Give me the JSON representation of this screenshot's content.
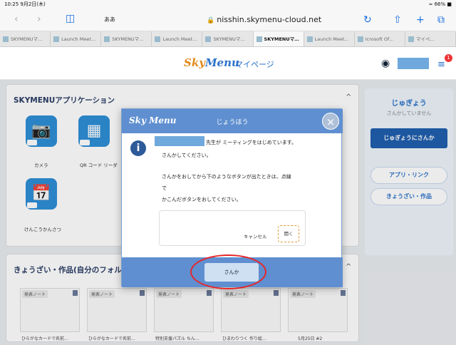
{
  "status": {
    "time": "10:25  9月2日(木)",
    "battery": "≈ 66% ■"
  },
  "browser": {
    "domain": "nisshin.skymenu-cloud.net",
    "aa": "ああ"
  },
  "tabs": [
    "SKYMENUマ…",
    "Launch Meet…",
    "SKYMENUマ…",
    "Launch Meet…",
    "SKYMENUマ…",
    "SKYMENUマ…",
    "Launch Meet…",
    "Icrosoft Of…",
    "マイペ…"
  ],
  "header": {
    "logo_a": "Sky",
    "logo_b": "Menu",
    "mypage": "マイページ",
    "badge": "1"
  },
  "apps_panel": {
    "title": "SKYMENUアプリケーション",
    "apps": [
      "カメラ",
      "QR コード リーダ",
      "けんこうかんさつ"
    ]
  },
  "works_panel": {
    "title": "きょうざい・作品(自分のフォルダ"
  },
  "thumbs": [
    {
      "tag": "発表ノート",
      "caption": "ひらがなカードで名前…"
    },
    {
      "tag": "発表ノート",
      "caption": "ひらがなカードで名前…"
    },
    {
      "tag": "発表ノート",
      "caption": "特別支援パズル ちん…"
    },
    {
      "tag": "発表ノート",
      "caption": "ひまわりつく 作り絵…"
    },
    {
      "tag": "発表ノート",
      "caption": "5月25日 #2"
    }
  ],
  "side": {
    "title": "じゅぎょう",
    "status": "さんかしていません",
    "join": "じゅぎょうにさんか",
    "link1": "アプリ・リンク",
    "link2": "きょうざい・作品"
  },
  "dialog": {
    "logo": "Sky Menu",
    "title": "じょうほう",
    "line1": "先生が ミーティングをはじめています。",
    "line2": "さんかしてください。",
    "line3": "さんかをおしてから下のようなボタンが出たときは、点線",
    "line4": "で",
    "line5": "かこんだボタンをおしてください。",
    "cancel": "キャンセル",
    "open": "開く",
    "join": "さんか"
  }
}
